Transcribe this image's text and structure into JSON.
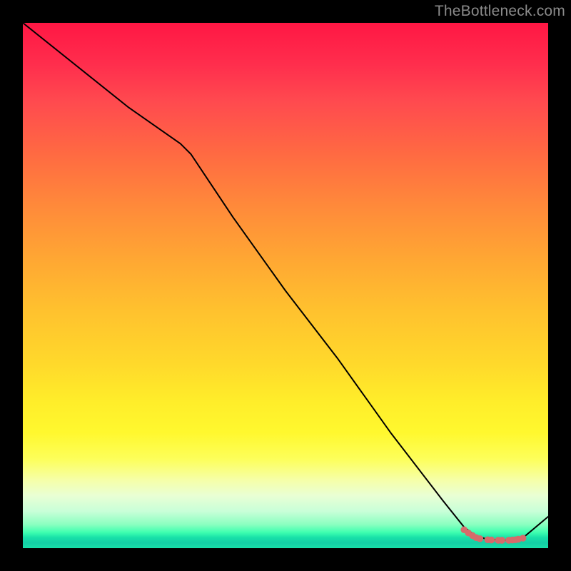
{
  "watermark": "TheBottleneck.com",
  "chart_data": {
    "type": "line",
    "title": "",
    "xlabel": "",
    "ylabel": "",
    "xlim": [
      0,
      100
    ],
    "ylim": [
      0,
      100
    ],
    "grid": false,
    "legend": false,
    "series": [
      {
        "name": "curve",
        "x": [
          0,
          10,
          20,
          30,
          32,
          40,
          50,
          60,
          70,
          80,
          84,
          86,
          88,
          90,
          92,
          93,
          94,
          95,
          100
        ],
        "y": [
          100,
          92,
          84,
          77,
          75,
          63,
          49,
          36,
          22,
          9,
          4,
          2.5,
          1.8,
          1.6,
          1.5,
          1.5,
          1.6,
          1.8,
          6
        ]
      }
    ],
    "markers": {
      "name": "bottom-dots",
      "color": "#d66b6b",
      "points": [
        {
          "x": 84.0,
          "y": 3.5
        },
        {
          "x": 84.8,
          "y": 2.9
        },
        {
          "x": 85.6,
          "y": 2.4
        },
        {
          "x": 86.3,
          "y": 2.0
        },
        {
          "x": 87.0,
          "y": 1.8
        },
        {
          "x": 88.5,
          "y": 1.6
        },
        {
          "x": 89.2,
          "y": 1.55
        },
        {
          "x": 90.5,
          "y": 1.5
        },
        {
          "x": 91.2,
          "y": 1.5
        },
        {
          "x": 92.5,
          "y": 1.5
        },
        {
          "x": 93.2,
          "y": 1.55
        },
        {
          "x": 93.8,
          "y": 1.6
        },
        {
          "x": 94.3,
          "y": 1.7
        },
        {
          "x": 95.2,
          "y": 1.9
        }
      ]
    }
  }
}
